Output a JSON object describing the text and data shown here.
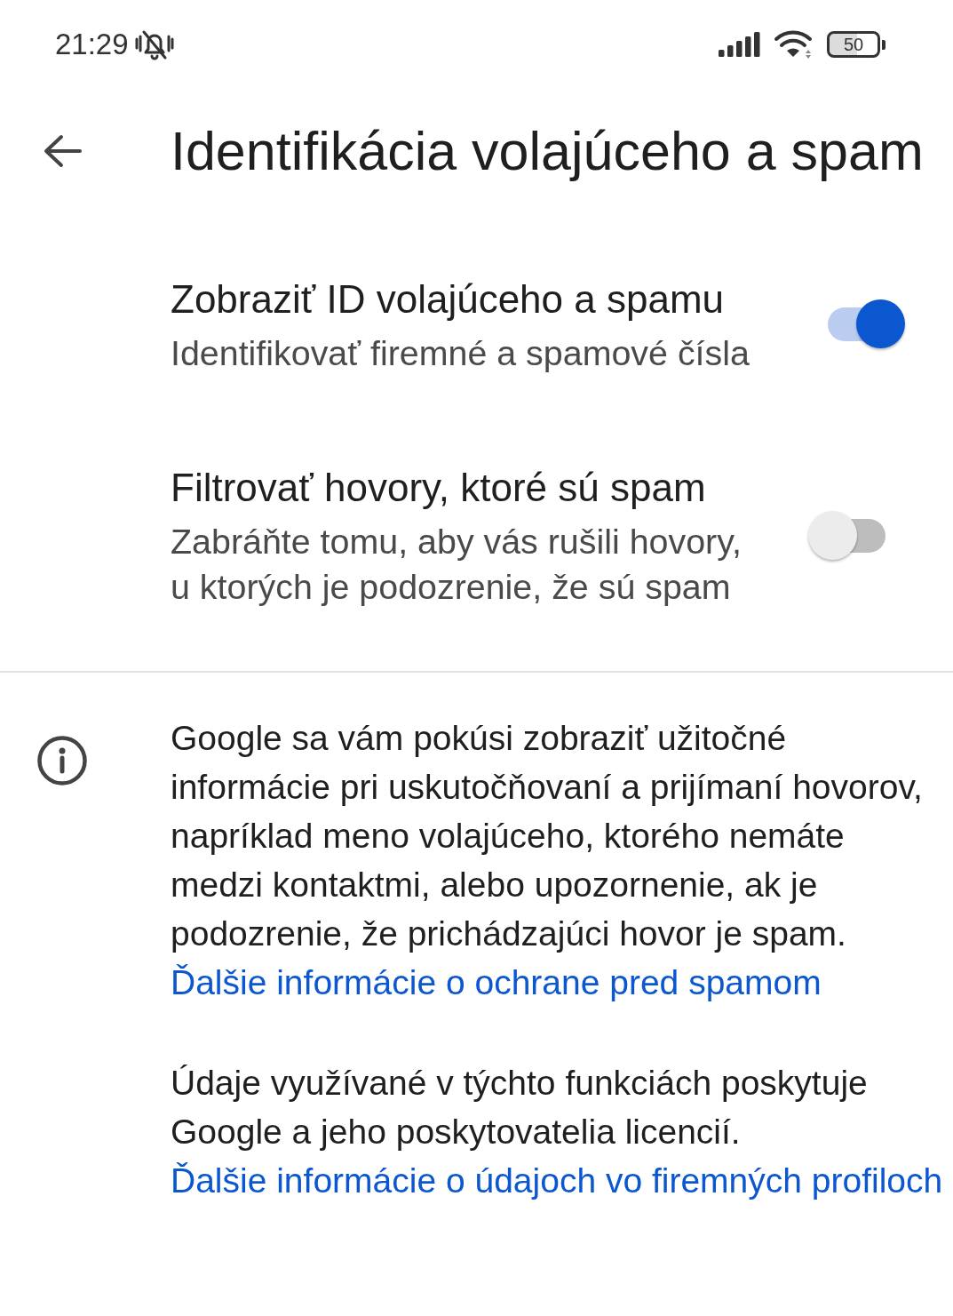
{
  "status_bar": {
    "time": "21:29",
    "battery": "50"
  },
  "app_bar": {
    "title": "Identifikácia volajúceho a spam"
  },
  "settings": [
    {
      "title": "Zobraziť ID volajúceho a spamu",
      "summary": "Identifikovať firemné a spamové čísla",
      "on": true
    },
    {
      "title": "Filtrovať hovory, ktoré sú spam",
      "summary": "Zabráňte tomu, aby vás rušili hovory, u ktorých je podozrenie, že sú spam",
      "on": false
    }
  ],
  "info": {
    "paragraphs": [
      {
        "text": "Google sa vám pokúsi zobraziť užitočné informácie pri uskutočňovaní a prijímaní hovorov, napríklad meno volajúceho, ktorého nemáte medzi kontaktmi, alebo upozornenie, ak je podozrenie, že prichádzajúci hovor je spam.",
        "link": "Ďalšie informácie o ochrane pred spamom"
      },
      {
        "text": "Údaje využívané v týchto funkciách poskytuje Google a jeho poskytovatelia licencií.",
        "link": "Ďalšie informácie o údajoch vo firemných profiloch"
      }
    ]
  }
}
